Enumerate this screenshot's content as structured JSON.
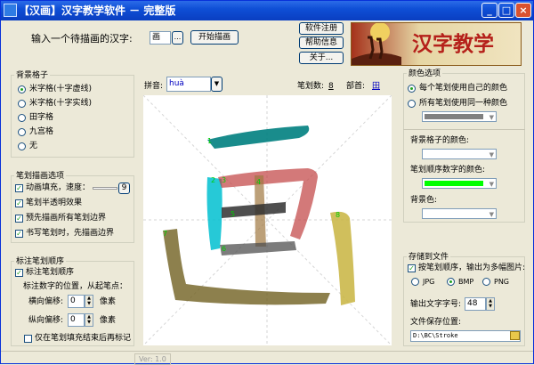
{
  "titlebar": {
    "title": "【汉画】汉字教学软件 － 完整版",
    "minimize_icon": "minimize-icon",
    "maximize_icon": "maximize-icon",
    "close_icon": "close-icon"
  },
  "input": {
    "prompt": "输入一个待描画的汉字:",
    "value": "画",
    "browse_label": "...",
    "start_button": "开始描画"
  },
  "buttons": {
    "register": "软件注册",
    "help": "帮助信息",
    "about": "关于..."
  },
  "banner": {
    "text": "汉字教学"
  },
  "info": {
    "pinyin_label": "拼音:",
    "pinyin_value": "huà",
    "strokes_label": "笔划数:",
    "strokes_value": "8",
    "radical_label": "部首:",
    "radical_value": "田"
  },
  "background_grid": {
    "title": "背景格子",
    "options": [
      "米字格(十字虚线)",
      "米字格(十字实线)",
      "田字格",
      "九宫格",
      "无"
    ],
    "selected": "米字格(十字虚线)"
  },
  "stroke_options": {
    "title": "笔划描画选项",
    "animate_label": "动画填充，速度：",
    "speed_value": "9",
    "translucent_label": "笔划半透明效果",
    "preborder_label": "预先描画所有笔划边界",
    "handwrite_label": "书写笔划时，先描画边界"
  },
  "stroke_order": {
    "title": "标注笔划顺序",
    "mark_label": "标注笔划顺序",
    "position_label": "标注数字的位置，从起笔点：",
    "hoffset_label": "横向偏移:",
    "hoffset_value": "0",
    "voffset_label": "纵向偏移:",
    "voffset_value": "0",
    "unit": "像素",
    "after_fill_label": "仅在笔划填充结束后再标记"
  },
  "color_options": {
    "title": "颜色选项",
    "own_color_label": "每个笔划使用自己的颜色",
    "same_color_label": "所有笔划使用同一种颜色",
    "grid_color_label": "背景格子的颜色:",
    "order_color_label": "笔划顺序数字的颜色:",
    "bg_color_label": "背景色:",
    "stroke_color": "#808080",
    "grid_color": "#ffffff",
    "order_color": "#00ff00",
    "bg_color": "#ffffff"
  },
  "save": {
    "title": "存储到文件",
    "save_label": "按笔划顺序，输出为多幅图片:",
    "formats": [
      "JPG",
      "BMP",
      "PNG"
    ],
    "selected_format": "BMP",
    "font_label": "输出文字字号:",
    "font_value": "48",
    "path_label": "文件保存位置:",
    "path_value": "D:\\BC\\Stroke",
    "folder_icon": "folder-icon"
  },
  "status": {
    "version": "Ver: 1.0"
  },
  "stroke_numbers": [
    "1",
    "2",
    "3",
    "4",
    "5",
    "6",
    "7",
    "8"
  ]
}
